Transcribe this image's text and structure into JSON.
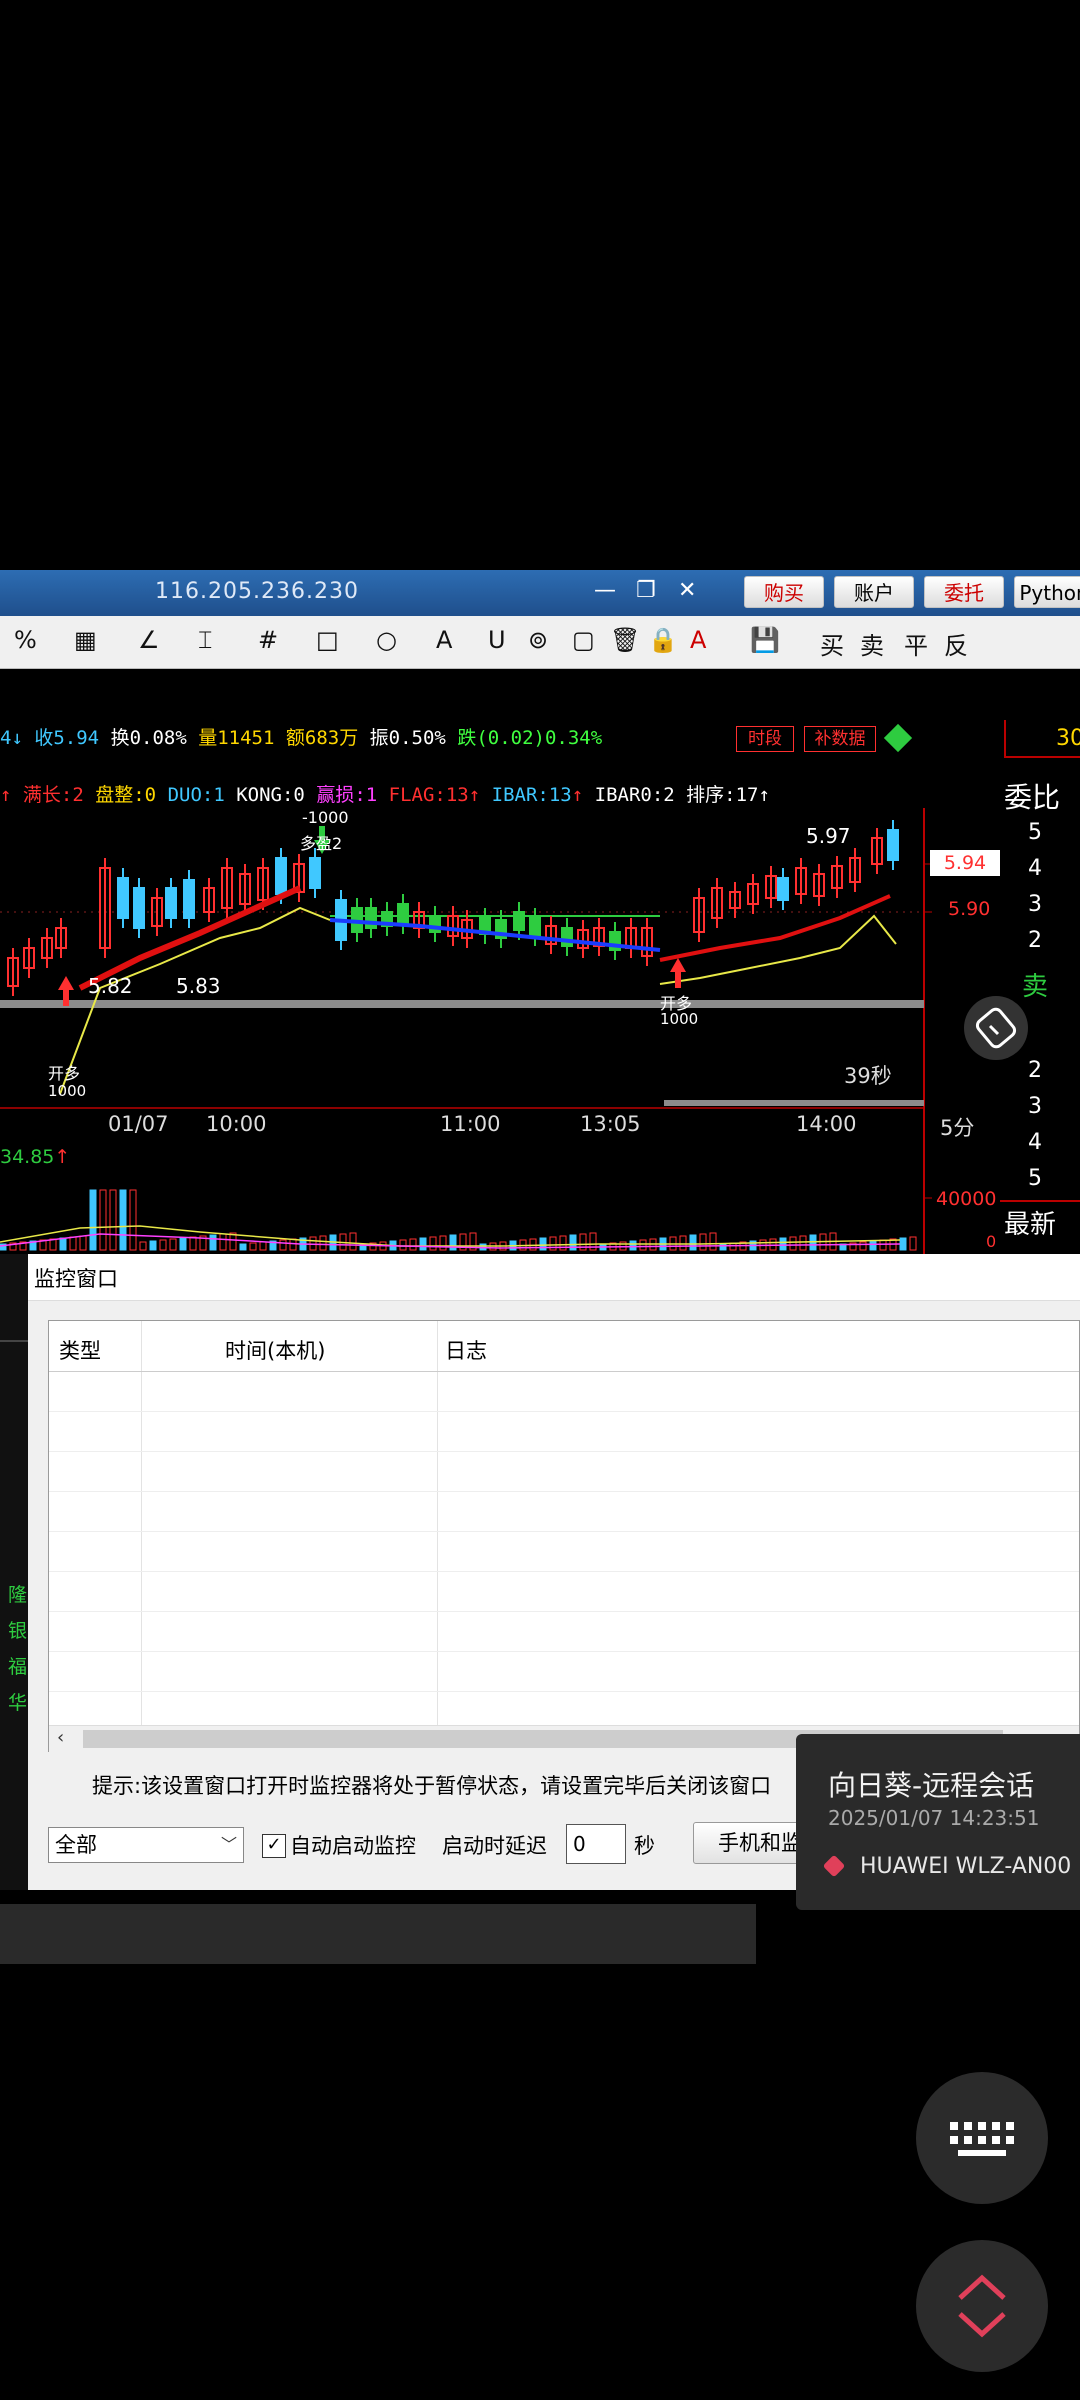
{
  "window": {
    "ip": "116.205.236.230",
    "buttons": [
      "购买",
      "账户",
      "委托",
      "Python"
    ],
    "controls": [
      "—",
      "❐",
      "✕"
    ]
  },
  "toolbar": {
    "items": [
      "%",
      "▦",
      "∠",
      "⌶",
      "#",
      "□",
      "○",
      "A",
      "U",
      "⊚",
      "▢",
      "🗑",
      "🔒",
      "A",
      "💾"
    ],
    "trade": [
      "买",
      "卖",
      "平",
      "反"
    ]
  },
  "quote": {
    "prefix": "4",
    "close": "收5.94",
    "turnover": "换0.08%",
    "volume": "量11451",
    "amount": "额683万",
    "amplitude": "振0.50%",
    "change": "跌(0.02)0.34%",
    "tag1": "时段",
    "tag2": "补数据",
    "right_top": "30"
  },
  "indicators": {
    "a": "满长:2",
    "b": "盘整:0",
    "c": "DUO:1",
    "d": "KONG:0",
    "e": "赢损:1",
    "f": "FLAG:13",
    "g": "IBAR:13",
    "h": "IBAR0:2",
    "i": "排序:17"
  },
  "chart_labels": {
    "peak": "5.97",
    "current_price": "5.94",
    "level": "5.90",
    "low1": "5.82",
    "low2": "5.83",
    "sig1": "-1000",
    "sig1_name": "多盈2",
    "open1": "开多",
    "open1_qty": "1000",
    "open2": "开多",
    "open2_qty": "1000",
    "timer": "39秒",
    "volume_value": "34.85",
    "volume_axis": "40000",
    "volume_zero": "0"
  },
  "time_axis": [
    "01/07",
    "10:00",
    "11:00",
    "13:05",
    "14:00"
  ],
  "period": "5分",
  "side": {
    "title": "委比",
    "asks": [
      "5",
      "4",
      "3",
      "2"
    ],
    "sell": "卖",
    "bids": [
      "2",
      "3",
      "4",
      "5"
    ],
    "latest": "最新"
  },
  "dialog": {
    "title": "监控窗口",
    "columns": [
      "类型",
      "时间(本机)",
      "日志"
    ],
    "hint": "提示:该设置窗口打开时监控器将处于暂停状态，请设置完毕后关闭该窗口",
    "filter": "全部",
    "auto_start_label": "自动启动监控",
    "delay_label": "启动时延迟",
    "delay_value": "0",
    "delay_unit": "秒",
    "phone_button": "手机和监"
  },
  "left_strip": [
    "隆",
    "银",
    "福",
    "华"
  ],
  "notification": {
    "title": "向日葵-远程会话",
    "time": "2025/01/07 14:23:51",
    "device": "HUAWEI WLZ-AN00"
  },
  "colors": {
    "up": "#ff3030",
    "down": "#40c8ff",
    "titlebar": "#2d6db3",
    "ma_red": "#e01010",
    "ma_blue": "#1a3cff",
    "ma_yellow": "#e8e848"
  }
}
